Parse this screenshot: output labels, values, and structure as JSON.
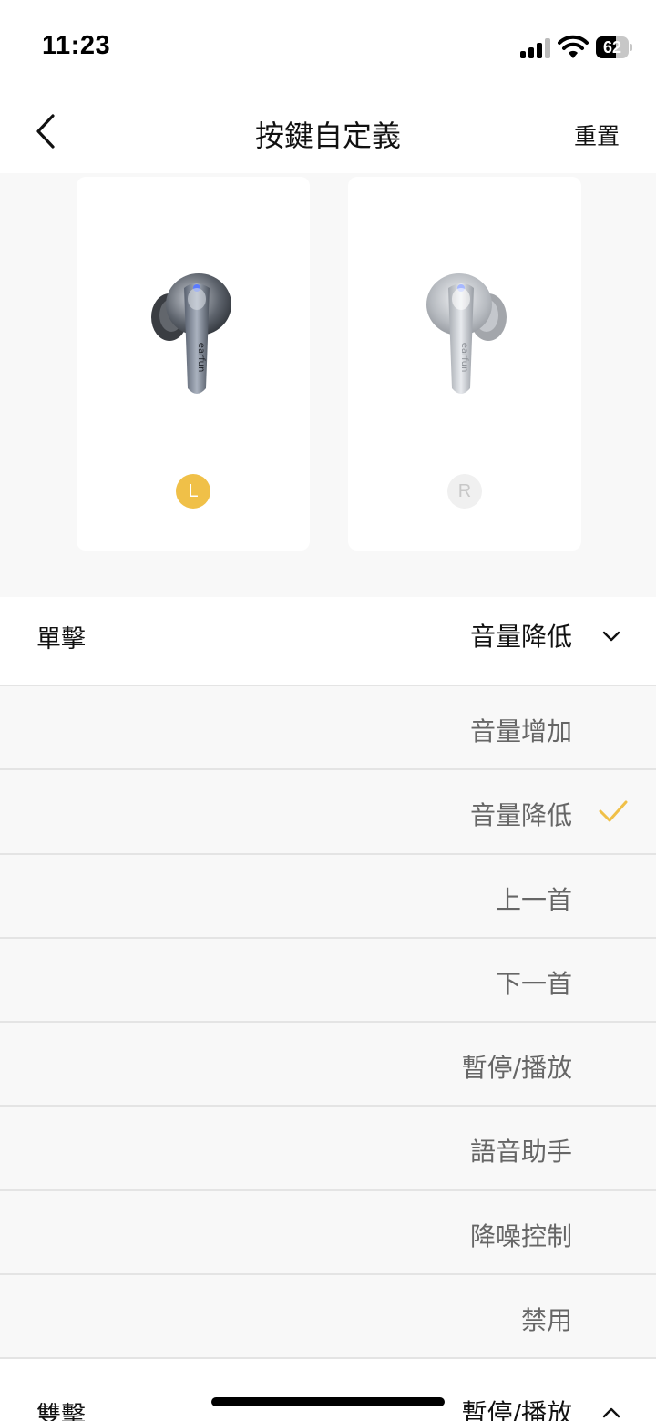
{
  "status_bar": {
    "time": "11:23",
    "battery": "62",
    "battery_level": 62
  },
  "nav": {
    "title": "按鍵自定義",
    "reset_label": "重置"
  },
  "earbuds": {
    "left": {
      "badge": "L",
      "selected": true
    },
    "right": {
      "badge": "R",
      "selected": false
    },
    "brand_text": "earfun"
  },
  "single_tap": {
    "label": "單擊",
    "value": "音量降低",
    "expanded": true
  },
  "options": [
    {
      "label": "音量增加",
      "selected": false
    },
    {
      "label": "音量降低",
      "selected": true
    },
    {
      "label": "上一首",
      "selected": false
    },
    {
      "label": "下一首",
      "selected": false
    },
    {
      "label": "暫停/播放",
      "selected": false
    },
    {
      "label": "語音助手",
      "selected": false
    },
    {
      "label": "降噪控制",
      "selected": false
    },
    {
      "label": "禁用",
      "selected": false
    }
  ],
  "double_tap": {
    "label": "雙擊",
    "value": "暫停/播放",
    "expanded": false
  },
  "colors": {
    "accent": "#f0c048",
    "panel_bg": "#f8f8f8",
    "divider": "#e4e4e4"
  }
}
